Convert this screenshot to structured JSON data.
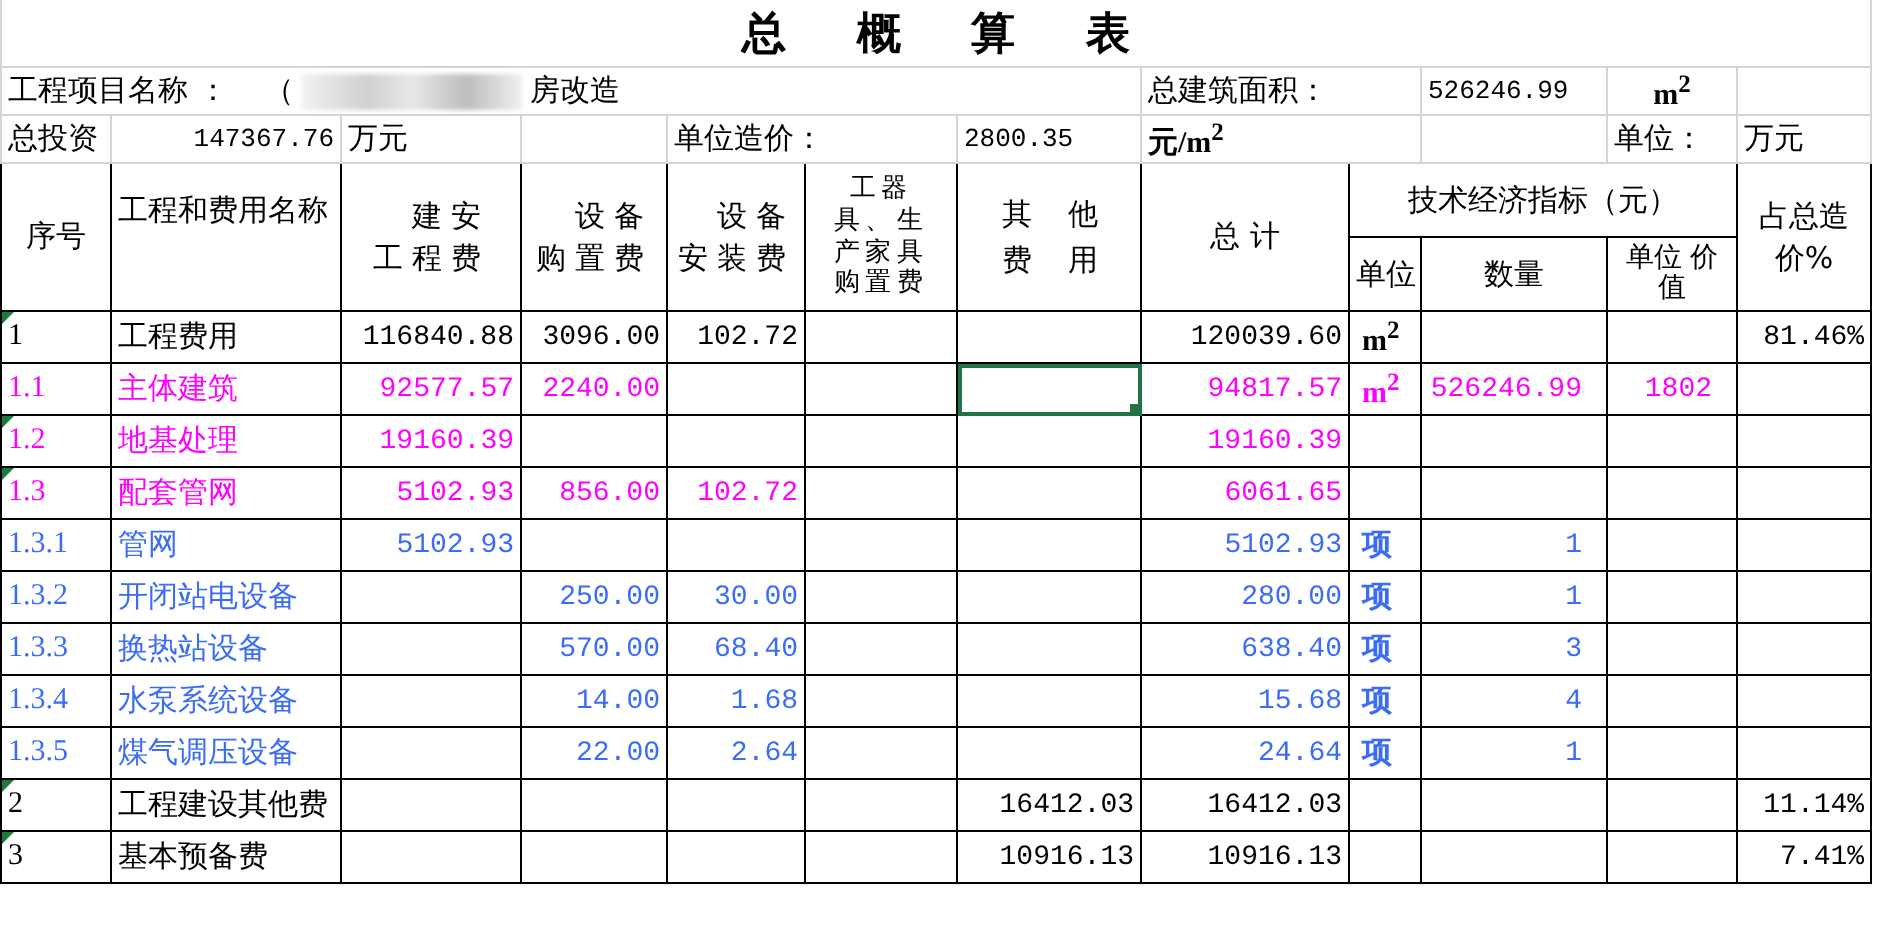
{
  "title": "总概算表",
  "info_row_1": {
    "project_label": "工程项目名称 ：",
    "project_name_start": "（",
    "project_name_end": "房改造",
    "area_label": "总建筑面积：",
    "area_value": "526246.99",
    "area_unit": "m$^{2}$"
  },
  "info_row_2": {
    "investment_label": "总投资",
    "investment_value": "147367.76",
    "investment_unit": "万元",
    "unit_cost_label": "单位造价：",
    "unit_cost_value": "2800.35",
    "unit_cost_unit": "元/m$^{2}$",
    "unit_label": "单位：",
    "unit_value": "万元"
  },
  "header": {
    "number": "序号",
    "name": "工程和费用名称",
    "construction": "建安工程费",
    "purchase": "设备购置费",
    "install": "设备安装费",
    "tools": "工器具、生产家具购置费",
    "other": "其他费用",
    "total": "总 计",
    "indicators": "技术经济指标（元）",
    "unit": "单位",
    "quantity": "数量",
    "unit_value": "单位 价值",
    "percent": "占总造价%"
  },
  "rows": [
    {
      "number": "1",
      "name": "工程费用",
      "color": "#000000",
      "flagged": true,
      "other_selected": false,
      "construction": "116840.88",
      "purchase": "3096.00",
      "install": "102.72",
      "total": "120039.60",
      "unit": "m$^{2}$",
      "percent": "81.46%"
    },
    {
      "number": "1.1",
      "name": "主体建筑",
      "color": "#ff00ff",
      "flagged": false,
      "other_selected": true,
      "construction": "92577.57",
      "purchase": "2240.00",
      "total": "94817.57",
      "unit": "m$^{2}$",
      "quantity": "526246.99",
      "unit_value": "1802"
    },
    {
      "number": "1.2",
      "name": "地基处理",
      "color": "#ff00ff",
      "flagged": true,
      "other_selected": false,
      "construction": "19160.39",
      "total": "19160.39"
    },
    {
      "number": "1.3",
      "name": "配套管网",
      "color": "#ff00ff",
      "flagged": true,
      "other_selected": false,
      "construction": "5102.93",
      "purchase": "856.00",
      "install": "102.72",
      "total": "6061.65"
    },
    {
      "number": "1.3.1",
      "name": "管网",
      "color": "#3b6cf5",
      "flagged": false,
      "other_selected": false,
      "construction": "5102.93",
      "total": "5102.93",
      "unit": "项",
      "quantity": "1"
    },
    {
      "number": "1.3.2",
      "name": "开闭站电设备",
      "color": "#3b6cf5",
      "flagged": false,
      "other_selected": false,
      "purchase": "250.00",
      "install": "30.00",
      "total": "280.00",
      "unit": "项",
      "quantity": "1"
    },
    {
      "number": "1.3.3",
      "name": "换热站设备",
      "color": "#3b6cf5",
      "flagged": false,
      "other_selected": false,
      "purchase": "570.00",
      "install": "68.40",
      "total": "638.40",
      "unit": "项",
      "quantity": "3"
    },
    {
      "number": "1.3.4",
      "name": "水泵系统设备",
      "color": "#3b6cf5",
      "flagged": false,
      "other_selected": false,
      "purchase": "14.00",
      "install": "1.68",
      "total": "15.68",
      "unit": "项",
      "quantity": "4"
    },
    {
      "number": "1.3.5",
      "name": "煤气调压设备",
      "color": "#3b6cf5",
      "flagged": false,
      "other_selected": false,
      "purchase": "22.00",
      "install": "2.64",
      "total": "24.64",
      "unit": "项",
      "quantity": "1"
    },
    {
      "number": "2",
      "name": "工程建设其他费",
      "color": "#000000",
      "flagged": true,
      "other_selected": false,
      "other": "16412.03",
      "total": "16412.03",
      "percent": "11.14%"
    },
    {
      "number": "3",
      "name": "基本预备费",
      "color": "#000000",
      "flagged": true,
      "other_selected": false,
      "other": "10916.13",
      "total": "10916.13",
      "percent": "7.41%"
    }
  ]
}
